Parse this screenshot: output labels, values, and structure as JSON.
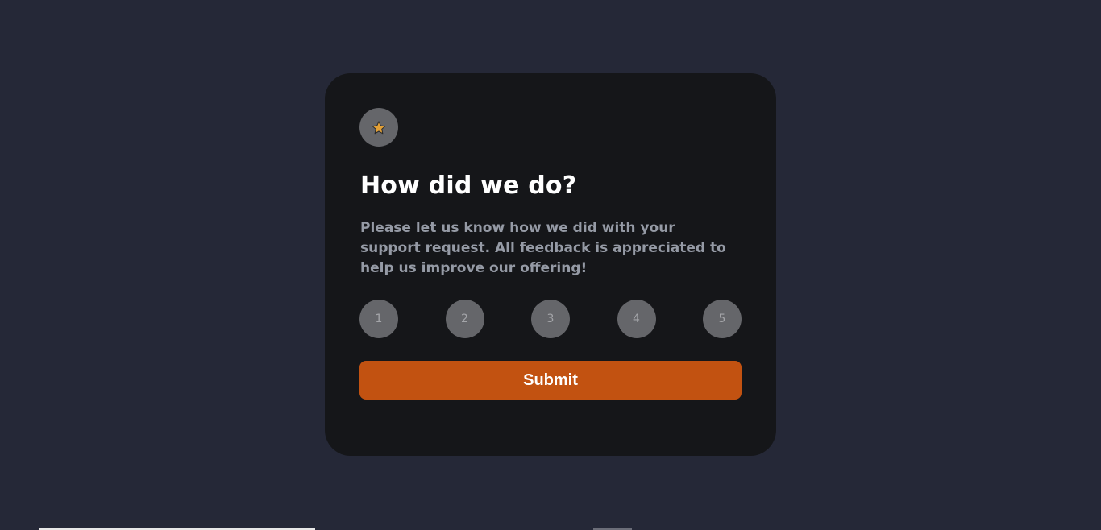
{
  "card": {
    "icon": "star-icon",
    "title": "How did we do?",
    "description": "Please let us know how we did with your support request. All feedback is appreciated to help us improve our offering!",
    "ratings": [
      "1",
      "2",
      "3",
      "4",
      "5"
    ],
    "submit_label": "Submit"
  },
  "colors": {
    "page_background": "#252837",
    "card_background": "#151619",
    "circle_background": "#65666a",
    "accent": "#c25211",
    "star": "#e2a037"
  }
}
